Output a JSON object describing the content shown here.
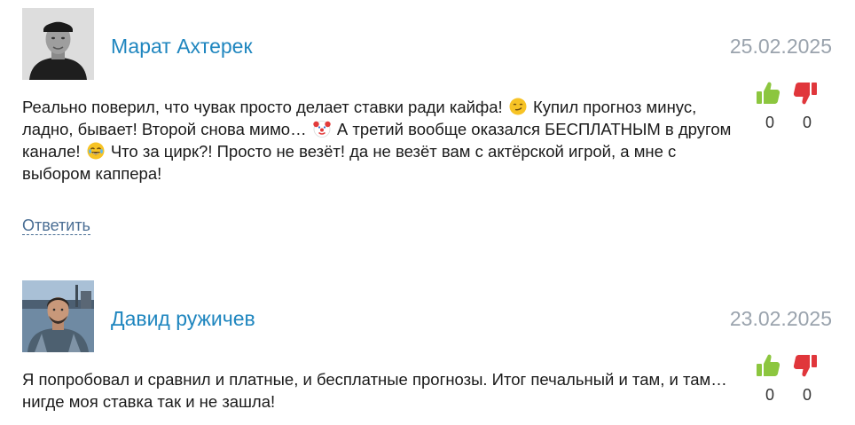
{
  "comments": [
    {
      "author": "Марат Ахтерек",
      "date": "25.02.2025",
      "text_parts": [
        "Реально поверил, что чувак просто делает ставки ради кайфа!",
        "Купил прогноз минус, ладно, бывает! Второй снова мимо…",
        "А третий вообще оказался БЕСПЛАТНЫМ в другом канале!",
        "Что за цирк?! Просто не везёт! да не везёт вам с актёрской игрой, а мне с выбором каппера!"
      ],
      "emojis": [
        "smirking-face-emoji",
        "clown-face-emoji",
        "joy-face-emoji"
      ],
      "likes": "0",
      "dislikes": "0",
      "reply_label": "Ответить"
    },
    {
      "author": "Давид ружичев",
      "date": "23.02.2025",
      "text": "Я попробовал и сравнил и платные, и бесплатные прогнозы. Итог печальный и там, и там… нигде моя ставка так и не зашла!",
      "likes": "0",
      "dislikes": "0"
    }
  ],
  "colors": {
    "author": "#1f86bf",
    "date": "#9aa3ad",
    "like": "#8cc63f",
    "dislike": "#e0363b",
    "reply": "#4a6e94"
  },
  "icons": {
    "like": "thumbs-up-icon",
    "dislike": "thumbs-down-icon"
  }
}
